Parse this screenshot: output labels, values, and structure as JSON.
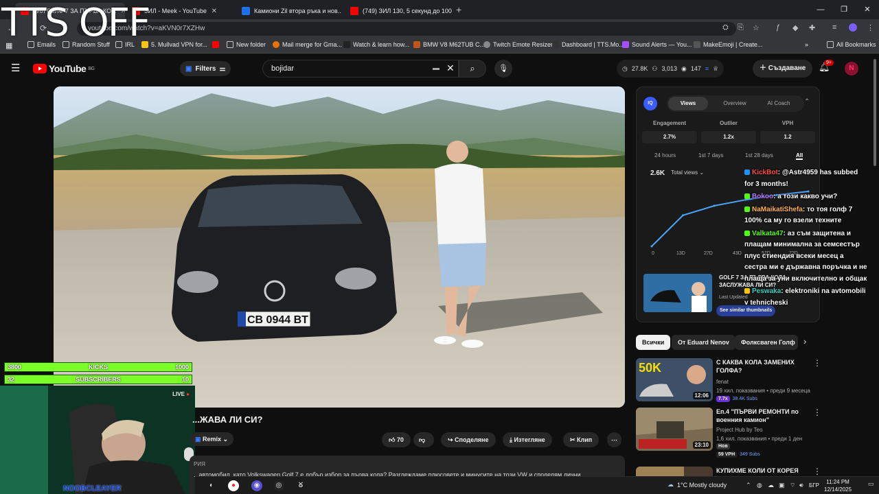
{
  "browser": {
    "tabs": [
      {
        "label": "ЗИЛ ГОЛФ 7 ЗА ПЪРВА КО...",
        "active": true,
        "favicon": "yt"
      },
      {
        "label": "ЗИЛ - Meek - YouTube",
        "active": false,
        "favicon": "yt"
      },
      {
        "label": "Камиони Zil втора ръка и нов...",
        "active": false,
        "favicon": "blue"
      },
      {
        "label": "(749) ЗИЛ 130, 5 секунд до 100...",
        "active": false,
        "favicon": "yt"
      }
    ],
    "new_tab": "+",
    "url": "youtube.com/watch?v=aKVN0r7XZHw",
    "bookmarks": [
      {
        "label": "Emails",
        "icon": "folder-icon"
      },
      {
        "label": "Random Stuff",
        "icon": "folder-icon"
      },
      {
        "label": "IRL",
        "icon": "folder-icon"
      },
      {
        "label": "5. Mullvad VPN for...",
        "icon": "vpn-icon"
      },
      {
        "label": "",
        "icon": "youtube-icon"
      },
      {
        "label": "New folder",
        "icon": "folder-icon"
      },
      {
        "label": "Mail merge for Gma...",
        "icon": "mail-icon"
      },
      {
        "label": "Watch & learn how...",
        "icon": "video-icon"
      },
      {
        "label": "BMW V8 M62TUB C...",
        "icon": "bmw-icon"
      },
      {
        "label": "Twitch Emote Resizer",
        "icon": "globe-icon"
      },
      {
        "label": "Dashboard | TTS.Mo...",
        "icon": "tts-icon"
      },
      {
        "label": "Sound Alerts — You...",
        "icon": "sound-icon"
      },
      {
        "label": "MakeEmoji | Create...",
        "icon": "emoji-icon"
      }
    ],
    "bookmarks_more": "»",
    "all_bookmarks": "All Bookmarks"
  },
  "youtube": {
    "logo_text": "YouTube",
    "logo_country": "BG",
    "filters_label": "Filters",
    "search_value": "bojidar",
    "stats": {
      "a": "27.8K",
      "b": "3,013",
      "c": "147"
    },
    "create_label": "Създаване",
    "notif_count": "9+",
    "avatar_letter": "N"
  },
  "overlay": {
    "tts_text": "TTS OFF",
    "kicks": {
      "left": "3800",
      "label": "KICKS",
      "right": "1000"
    },
    "subs": {
      "left": "32",
      "label": "SUBSCRIBERS",
      "right": "10"
    },
    "live_label": "LIVE",
    "cam_name": "NOOBCLEAYER"
  },
  "video": {
    "plate": "CB 0944 BT",
    "title": "...ЖАВА ЛИ СИ?",
    "remix_label": "Remix",
    "likes": "70",
    "share_label": "Споделяне",
    "download_label": "Изтегляне",
    "clip_label": "Клип",
    "desc_label": "РИЯ",
    "desc_text": "...автомобил, като Volkswagen Golf 7 е добър избор за първа кола? Разглеждаме плюсовете и минусите на този VW и споделям лични"
  },
  "iq": {
    "badge": "IQ",
    "tabs": [
      "Views",
      "Overview",
      "AI Coach"
    ],
    "metrics": [
      {
        "label": "Engagement",
        "value": "2.7%"
      },
      {
        "label": "Outlier",
        "value": "1.2x"
      },
      {
        "label": "VPH",
        "value": "1.2"
      }
    ],
    "ranges": [
      "24 hours",
      "1st 7 days",
      "1st 28 days",
      "All"
    ],
    "views_value": "2.6K",
    "views_dropdown": "Total views",
    "x_ticks": [
      "0",
      "13D",
      "27D",
      "43D",
      "57D",
      "72D"
    ],
    "suggest_title": "GOLF 7 ЗА ПЪРВА КОЛА - ЗАСЛУЖАВА ЛИ СИ?",
    "last_updated": "Last Updated",
    "see_similar": "See similar thumbnails"
  },
  "chart_data": {
    "type": "line",
    "x": [
      "0",
      "13D",
      "27D",
      "43D",
      "57D",
      "72D"
    ],
    "series": [
      {
        "values": [
          0,
          1300,
          1700,
          1950,
          2150,
          2300
        ]
      }
    ],
    "ylabel": "",
    "title": ""
  },
  "chat": [
    {
      "user": "KickBot",
      "color": "#ff4a4a",
      "text": ": @Astr4959 has subbed for 3 months!",
      "badge": "#1e90ff"
    },
    {
      "user": "Bokoo",
      "color": "#b77bff",
      "text": ": а този какво учи?",
      "badge": "#53fc18"
    },
    {
      "user": "NaMaikatiShefa",
      "color": "#ffb347",
      "text": ": то тоя голф 7 100% са му го взели техните",
      "badge": "#53fc18"
    },
    {
      "user": "Valkata47",
      "color": "#53fc18",
      "text": ": аз съм защитена и плащам минимална за семсестър плус стиендия всеки месец а сестра ми е държавна поръчка и не плаща за уни включително и общак",
      "badge": "#53fc18"
    },
    {
      "user": "Peswaka",
      "color": "#2ed3c6",
      "text": ": elektroniki na avtomobili v tehnicheski",
      "badge": "#ffc400"
    }
  ],
  "chips": [
    "Всички",
    "От Eduard Nenov",
    "Фолксваген Голф"
  ],
  "recs": [
    {
      "title": "С КАКВА КОЛА ЗАМЕНИХ ГОЛФА?",
      "channel": "fenat",
      "meta": "19 хил. показвания • преди 9 месеца",
      "duration": "12:06",
      "badge1": "7.7x",
      "badge2": "38.4K Subs",
      "thumb": "#3a4a60"
    },
    {
      "title": "Еп.4 \"ПЪРВИ РЕМОНТИ по военния камион\"",
      "channel": "Project Hub by Teo",
      "meta": "1,6 хил. показвания • преди 1 ден",
      "duration": "23:10",
      "badge0": "Нов",
      "badge1": "59 VPH",
      "badge2": "349 Subs",
      "thumb": "#6a5a48"
    },
    {
      "title": "КУПИХМЕ КОЛИ ОТ КОРЕЯ",
      "channel": "",
      "meta": "",
      "duration": "",
      "badge1": "",
      "badge2": "",
      "thumb": "#4a3a30"
    }
  ],
  "taskbar": {
    "weather": "1°C  Mostly cloudy",
    "lang": "БГР",
    "time": "11:24 PM",
    "date": "12/14/2025"
  }
}
